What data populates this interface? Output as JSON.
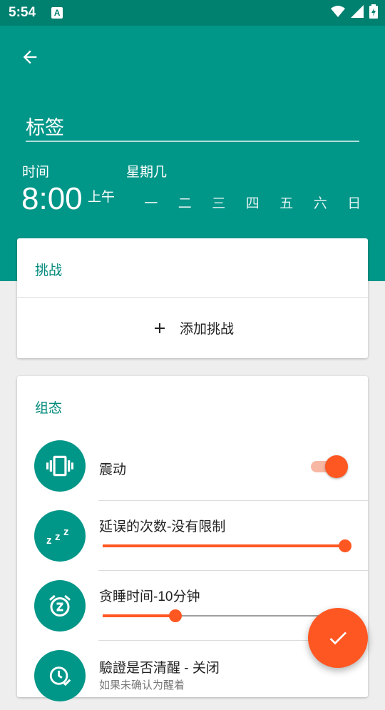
{
  "status_bar": {
    "time": "5:54",
    "notification_letter": "A"
  },
  "header": {
    "label_text": "标签",
    "time_caption": "时间",
    "weekday_caption": "星期几",
    "time_value": "8:00",
    "ampm": "上午",
    "days": [
      "一",
      "二",
      "三",
      "四",
      "五",
      "六",
      "日"
    ]
  },
  "challenge_card": {
    "title": "挑战",
    "add_label": "添加挑战"
  },
  "config_card": {
    "title": "组态",
    "vibrate_label": "震动",
    "vibrate_enabled": true,
    "snooze_count_label": "延误的次数-没有限制",
    "snooze_count_fraction": 1.0,
    "snooze_time_label": "贪睡时间-10分钟",
    "snooze_time_fraction": 0.3,
    "verify_awake_label": "驗證是否清醒 - 关闭",
    "verify_awake_sub": "如果未确认为醒着"
  },
  "colors": {
    "primary": "#009688",
    "primary_dark": "#00806f",
    "accent": "#ff5722"
  },
  "icons": {
    "back": "arrow-left-icon",
    "add": "plus-icon",
    "vibrate": "vibration-icon",
    "snooze_count": "zzz-icon",
    "snooze_time": "alarm-z-icon",
    "verify": "clock-check-icon",
    "fab": "check-icon"
  }
}
